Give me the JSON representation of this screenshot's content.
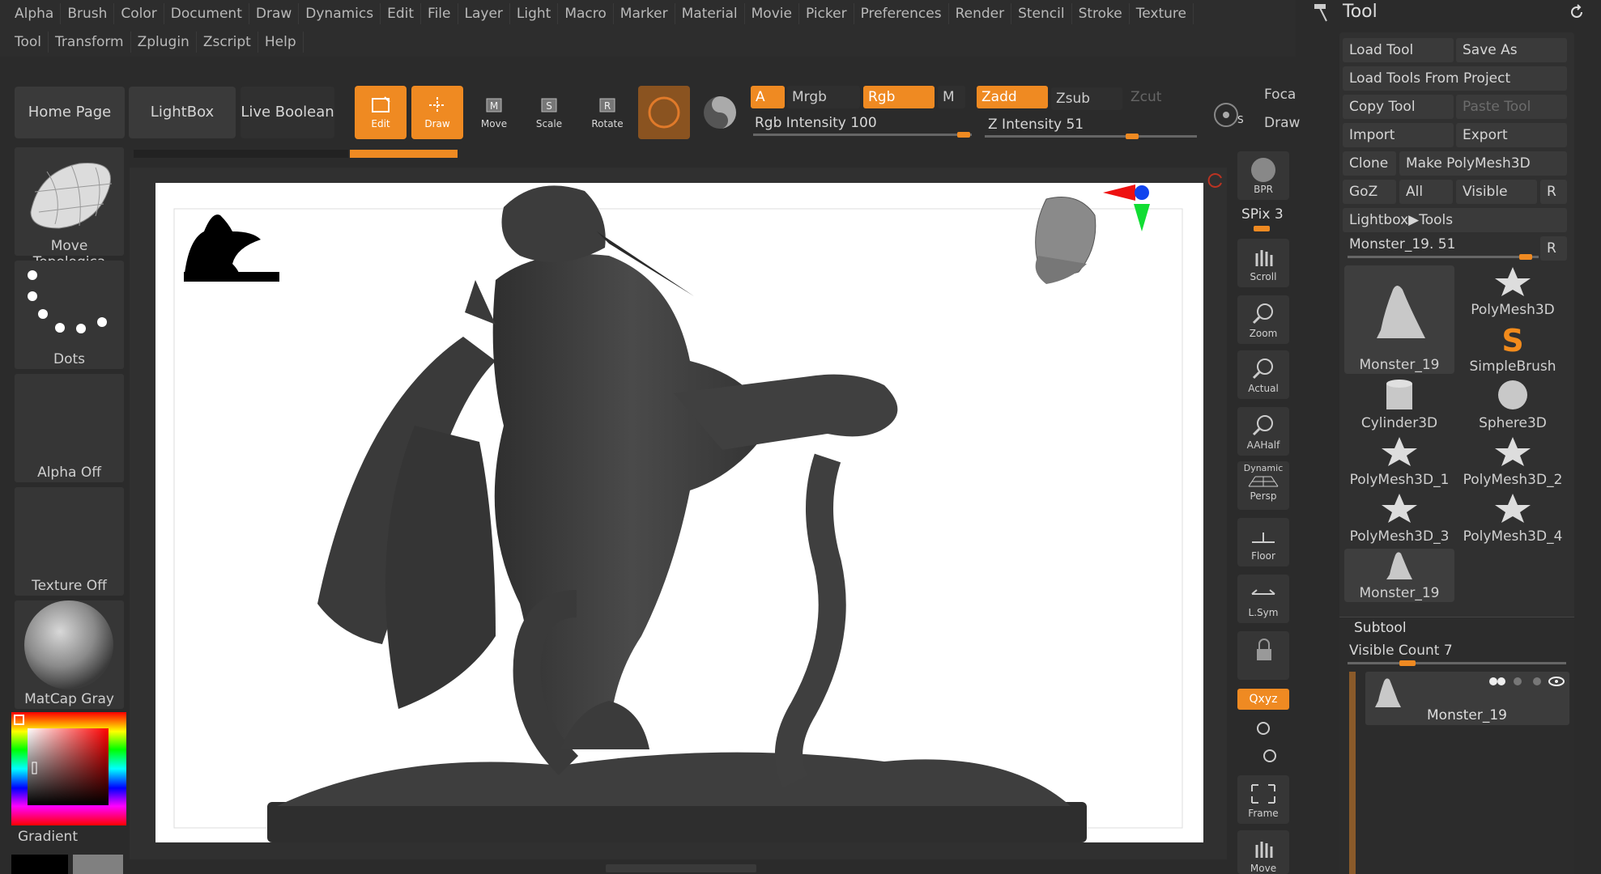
{
  "menu": {
    "row1": [
      "Alpha",
      "Brush",
      "Color",
      "Document",
      "Draw",
      "Dynamics",
      "Edit",
      "File",
      "Layer",
      "Light",
      "Macro",
      "Marker",
      "Material",
      "Movie",
      "Picker",
      "Preferences",
      "Render",
      "Stencil",
      "Stroke",
      "Texture"
    ],
    "row2": [
      "Tool",
      "Transform",
      "Zplugin",
      "Zscript",
      "Help"
    ]
  },
  "shelf": {
    "home_page": "Home Page",
    "lightbox": "LightBox",
    "live_boolean": "Live Boolean",
    "edit": "Edit",
    "draw": "Draw",
    "move": "Move",
    "scale": "Scale",
    "rotate": "Rotate",
    "a": "A",
    "mrgb": "Mrgb",
    "rgb": "Rgb",
    "m": "M",
    "zadd": "Zadd",
    "zsub": "Zsub",
    "zcut": "Zcut",
    "rgb_intensity": "Rgb Intensity 100",
    "z_intensity": "Z Intensity 51",
    "focal": "Foca",
    "draw_size": "Draw"
  },
  "left_tray": {
    "brush": "Move Topologica",
    "stroke": "Dots",
    "alpha": "Alpha Off",
    "texture": "Texture Off",
    "material": "MatCap Gray",
    "gradient": "Gradient"
  },
  "right_shelf": {
    "bpr": "BPR",
    "spix": "SPix 3",
    "scroll": "Scroll",
    "zoom": "Zoom",
    "actual": "Actual",
    "aahalf": "AAHalf",
    "persp_top": "Dynamic",
    "persp": "Persp",
    "floor": "Floor",
    "lsym": "L.Sym",
    "xyz": "Qxyz",
    "frame": "Frame",
    "move": "Move"
  },
  "tool_palette": {
    "title": "Tool",
    "load_tool": "Load Tool",
    "save_as": "Save As",
    "load_from_project": "Load Tools From Project",
    "copy_tool": "Copy Tool",
    "paste_tool": "Paste Tool",
    "import": "Import",
    "export": "Export",
    "clone": "Clone",
    "make_polymesh": "Make PolyMesh3D",
    "goz": "GoZ",
    "all": "All",
    "visible": "Visible",
    "r": "R",
    "lightbox_tools": "Lightbox▶Tools",
    "current_tool_slider": "Monster_19. 51",
    "thumbs": [
      "Monster_19",
      "PolyMesh3D",
      "SimpleBrush",
      "Cylinder3D",
      "Sphere3D",
      "PolyMesh3D_1",
      "PolyMesh3D_2",
      "PolyMesh3D_3",
      "PolyMesh3D_4",
      "Monster_19"
    ],
    "subtool_title": "Subtool",
    "visible_count": "Visible Count 7",
    "subtool_item": "Monster_19"
  },
  "colors": {
    "accent": "#ef8a22",
    "panel": "#2b2b2b",
    "button": "#3a3a3a"
  }
}
